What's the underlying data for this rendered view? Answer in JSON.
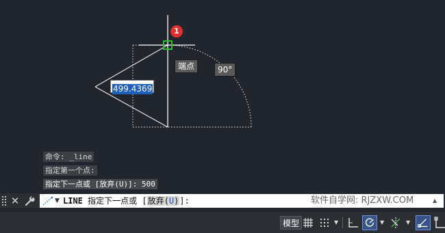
{
  "drawing": {
    "length_input": "499.4369",
    "snap_tooltip": "端点",
    "angle_tooltip": "90°",
    "step_badge": "1"
  },
  "command_history": [
    {
      "text": "命令: _line"
    },
    {
      "text": "指定第一个点:"
    },
    {
      "text": "指定下一点或 [放弃(U)]: 500"
    }
  ],
  "command_line": {
    "keyword": "LINE",
    "prompt_prefix": "指定下一点或 [",
    "option_label": "放弃(",
    "option_key": "U",
    "option_close": ")",
    "prompt_suffix": "]:",
    "watermark": "软件自学网: RJZXW.COM",
    "icons": {
      "close": "close-icon",
      "customize": "wrench-icon",
      "recent": "command-line-icon"
    }
  },
  "status_bar": {
    "model_label": "模型",
    "icons": [
      "grid-icon",
      "snap-icon",
      "ortho-icon",
      "polar-tracking-icon",
      "object-snap-tracking-icon",
      "object-snap-icon"
    ]
  },
  "colors": {
    "background": "#21252e",
    "geometry": "#ffffff",
    "snap_marker": "#27c22b",
    "badge": "#e0302f",
    "selection": "#1f5fbf"
  }
}
